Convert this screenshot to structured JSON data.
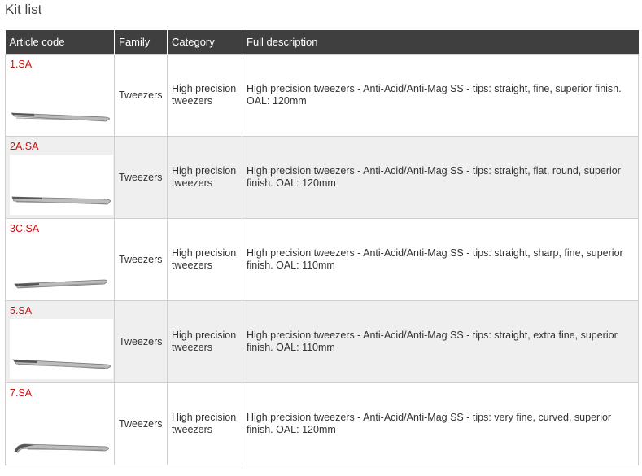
{
  "page": {
    "title": "Kit list"
  },
  "table": {
    "headers": [
      "Article code",
      "Family",
      "Category",
      "Full description"
    ],
    "rows": [
      {
        "code": "1.SA",
        "family": "Tweezers",
        "category": "High precision tweezers",
        "description": "High precision tweezers - Anti-Acid/Anti-Mag SS - tips: straight, fine, superior finish. OAL: 120mm",
        "image": "tweezers-straight-fine"
      },
      {
        "code": "2A.SA",
        "family": "Tweezers",
        "category": "High precision tweezers",
        "description": "High precision tweezers - Anti-Acid/Anti-Mag SS - tips: straight, flat, round, superior finish. OAL: 120mm",
        "image": "tweezers-straight-flat-round"
      },
      {
        "code": "3C.SA",
        "family": "Tweezers",
        "category": "High precision tweezers",
        "description": "High precision tweezers - Anti-Acid/Anti-Mag SS - tips: straight, sharp, fine, superior finish. OAL: 110mm",
        "image": "tweezers-straight-sharp-fine"
      },
      {
        "code": "5.SA",
        "family": "Tweezers",
        "category": "High precision tweezers",
        "description": "High precision tweezers - Anti-Acid/Anti-Mag SS - tips: straight, extra fine, superior finish. OAL: 110mm",
        "image": "tweezers-straight-extra-fine"
      },
      {
        "code": "7.SA",
        "family": "Tweezers",
        "category": "High precision tweezers",
        "description": "High precision tweezers - Anti-Acid/Anti-Mag SS - tips: very fine, curved, superior finish. OAL: 120mm",
        "image": "tweezers-curved-very-fine"
      }
    ]
  },
  "colors": {
    "header_bg": "#3f3f3f",
    "code_text": "#cc1111",
    "alt_row_bg": "#efefef"
  }
}
